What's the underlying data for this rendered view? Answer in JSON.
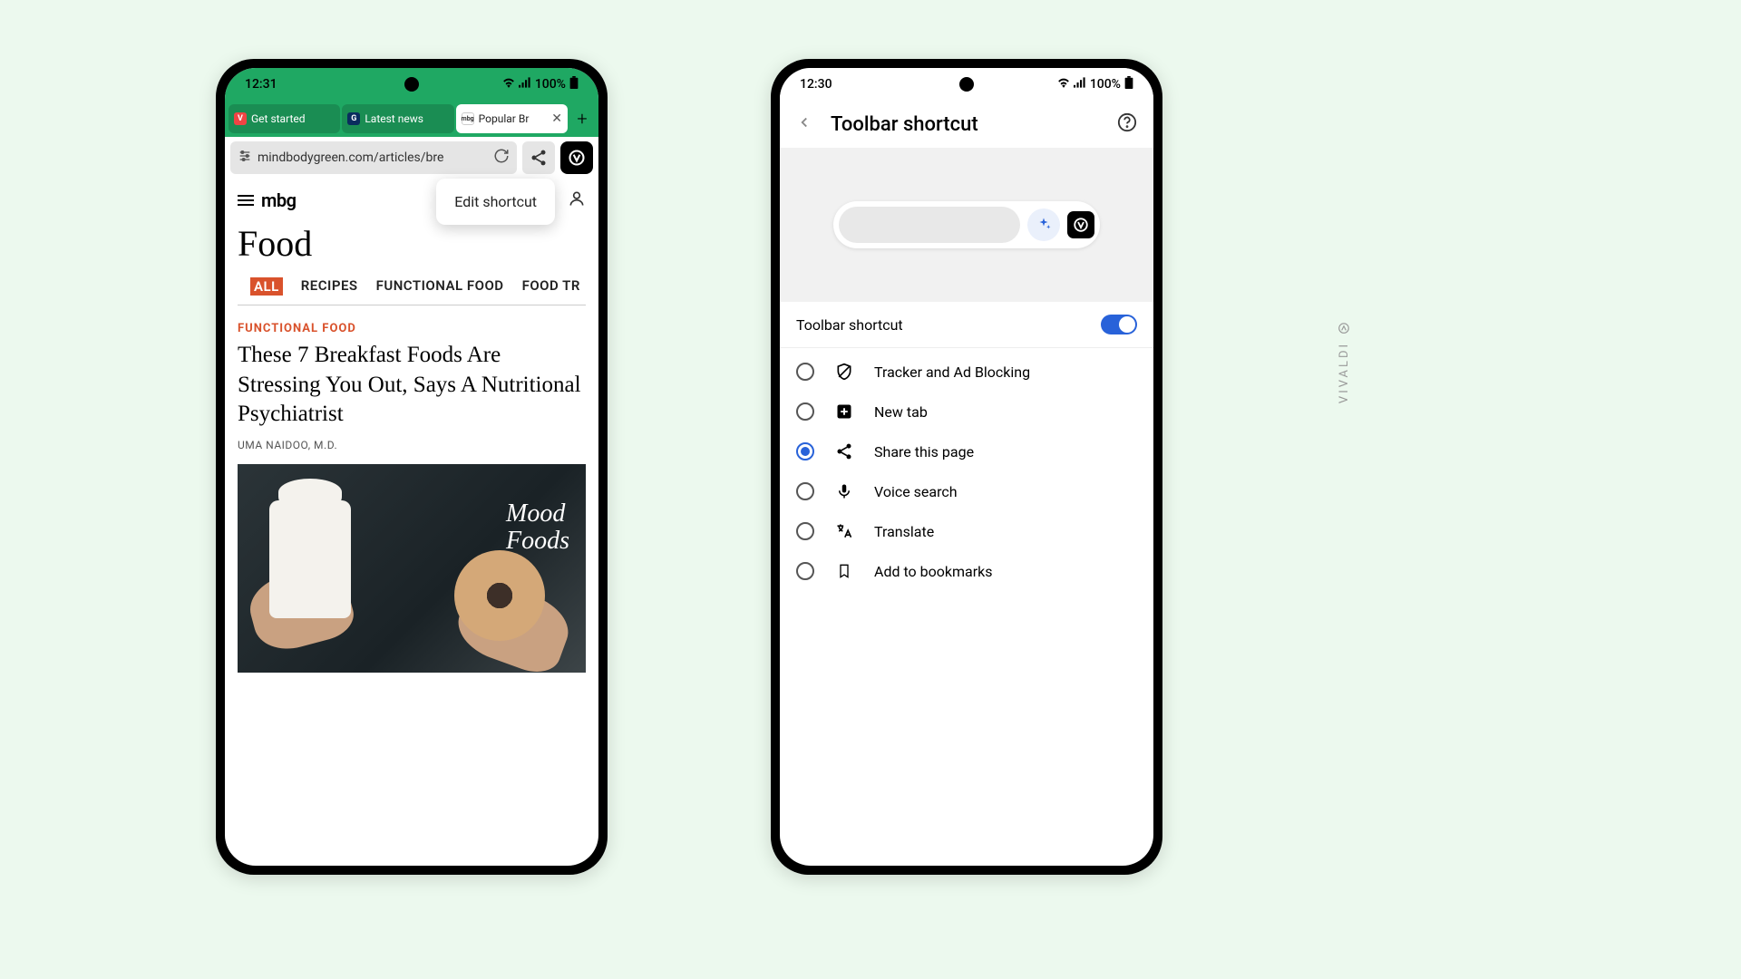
{
  "phone1": {
    "status": {
      "time": "12:31",
      "battery": "100%"
    },
    "tabs": [
      {
        "label": "Get started"
      },
      {
        "label": "Latest news"
      },
      {
        "label": "Popular Br",
        "active": true
      }
    ],
    "url": "mindbodygreen.com/articles/bre",
    "popup": "Edit shortcut",
    "page": {
      "logo": "mbg",
      "section": "Food",
      "categories": [
        "ALL",
        "RECIPES",
        "FUNCTIONAL FOOD",
        "FOOD TR"
      ],
      "kicker": "FUNCTIONAL FOOD",
      "headline": "These 7 Breakfast Foods Are Stressing You Out, Says A Nutritional Psychiatrist",
      "byline": "UMA NAIDOO, M.D.",
      "imageOverlay1": "Mood",
      "imageOverlay2": "Foods"
    }
  },
  "phone2": {
    "status": {
      "time": "12:30",
      "battery": "100%"
    },
    "header": "Toolbar shortcut",
    "toggleLabel": "Toolbar shortcut",
    "options": [
      {
        "label": "Tracker and Ad Blocking",
        "selected": false
      },
      {
        "label": "New tab",
        "selected": false
      },
      {
        "label": "Share this page",
        "selected": true
      },
      {
        "label": "Voice search",
        "selected": false
      },
      {
        "label": "Translate",
        "selected": false
      },
      {
        "label": "Add to bookmarks",
        "selected": false
      }
    ]
  },
  "watermark": "VIVALDI"
}
